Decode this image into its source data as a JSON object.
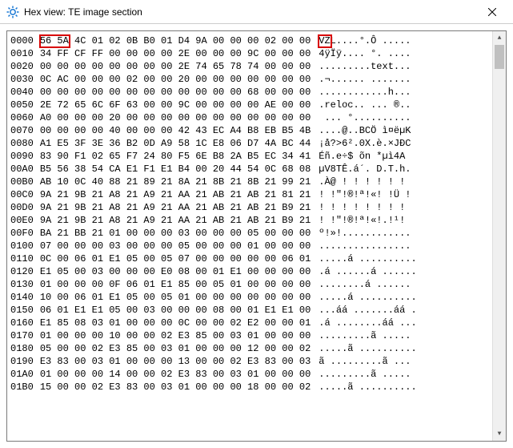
{
  "window": {
    "title": "Hex view: TE image section"
  },
  "highlights": {
    "hex_bytes": "56 5A",
    "ascii_chars": "VZ"
  },
  "rows": [
    {
      "offset": "0000",
      "hex": "56 5A 4C 01 02 0B B0 01 D4 9A 00 00 00 02 00 00",
      "ascii": "VZL....°.Ô ....."
    },
    {
      "offset": "0010",
      "hex": "34 FF CF FF 00 00 00 00 2E 00 00 00 9C 00 00 00",
      "ascii": "4ÿÏÿ.... °. ...."
    },
    {
      "offset": "0020",
      "hex": "00 00 00 00 00 00 00 00 2E 74 65 78 74 00 00 00",
      "ascii": ".........text..."
    },
    {
      "offset": "0030",
      "hex": "0C AC 00 00 00 02 00 00 20 00 00 00 00 00 00 00",
      "ascii": ".¬...... ......."
    },
    {
      "offset": "0040",
      "hex": "00 00 00 00 00 00 00 00 00 00 00 00 68 00 00 00",
      "ascii": "............h..."
    },
    {
      "offset": "0050",
      "hex": "2E 72 65 6C 6F 63 00 00 9C 00 00 00 00 AE 00 00",
      "ascii": ".reloc.. ... ®.."
    },
    {
      "offset": "0060",
      "hex": "A0 00 00 00 20 00 00 00 00 00 00 00 00 00 00 00",
      "ascii": " ... °.........."
    },
    {
      "offset": "0070",
      "hex": "00 00 00 00 40 00 00 00 42 43 EC A4 B8 EB B5 4B",
      "ascii": "....@..BCÖ ì¤ëµK"
    },
    {
      "offset": "0080",
      "hex": "A1 E5 3F 3E 36 B2 0D A9 58 1C E8 06 D7 4A BC 44",
      "ascii": "¡å?>6².0X.è.×JÐC"
    },
    {
      "offset": "0090",
      "hex": "83 90 F1 02 65 F7 24 80 F5 6E B8 2A B5 EC 34 41",
      "ascii": "Éñ.e÷$ õn *µì4A"
    },
    {
      "offset": "00A0",
      "hex": "B5 56 38 54 CA E1 F1 E1 B4 00 20 44 54 0C 68 08",
      "ascii": "µV8TÊ.á´. D.T.h."
    },
    {
      "offset": "00B0",
      "hex": "AB 10 0C 40 88 21 89 21 8A 21 8B 21 8B 21 99 21",
      "ascii": ".À@ ! ! ! ! ! !"
    },
    {
      "offset": "00C0",
      "hex": "9A 21 9B 21 A8 21 A9 21 AA 21 AB 21 AB 21 81 21",
      "ascii": "! !″!®!ª!«! !Ü !"
    },
    {
      "offset": "00D0",
      "hex": "9A 21 9B 21 A8 21 A9 21 AA 21 AB 21 AB 21 B9 21",
      "ascii": "! ! ! ! ! ! ! !"
    },
    {
      "offset": "00E0",
      "hex": "9A 21 9B 21 A8 21 A9 21 AA 21 AB 21 AB 21 B9 21",
      "ascii": "! !″!®!ª!«!.!¹!"
    },
    {
      "offset": "00F0",
      "hex": "BA 21 BB 21 01 00 00 00 03 00 00 00 05 00 00 00",
      "ascii": "º!»!............"
    },
    {
      "offset": "0100",
      "hex": "07 00 00 00 03 00 00 00 05 00 00 00 01 00 00 00",
      "ascii": "................"
    },
    {
      "offset": "0110",
      "hex": "0C 00 06 01 E1 05 00 05 07 00 00 00 00 00 06 01",
      "ascii": ".....á .........."
    },
    {
      "offset": "0120",
      "hex": "E1 05 00 03 00 00 00 E0 08 00 01 E1 00 00 00 00",
      "ascii": ".á ......á ......"
    },
    {
      "offset": "0130",
      "hex": "01 00 00 00 0F 06 01 E1 85 00 05 01 00 00 00 00",
      "ascii": "........á ......"
    },
    {
      "offset": "0140",
      "hex": "10 00 06 01 E1 05 00 05 01 00 00 00 00 00 00 00",
      "ascii": ".....á .........."
    },
    {
      "offset": "0150",
      "hex": "06 01 E1 E1 05 00 03 00 00 00 08 00 01 E1 E1 00",
      "ascii": "...áá .......áá ."
    },
    {
      "offset": "0160",
      "hex": "E1 85 08 03 01 00 00 00 0C 00 00 02 E2 00 00 01",
      "ascii": ".á ........áá ..."
    },
    {
      "offset": "0170",
      "hex": "01 00 00 00 10 00 00 02 E3 85 00 03 01 00 00 00",
      "ascii": ".........ã ....."
    },
    {
      "offset": "0180",
      "hex": "05 00 00 02 E3 85 00 03 01 00 00 00 12 00 00 02",
      "ascii": ".....ã .........."
    },
    {
      "offset": "0190",
      "hex": "E3 83 00 03 01 00 00 00 13 00 00 02 E3 83 00 03",
      "ascii": "ã .........ã ..."
    },
    {
      "offset": "01A0",
      "hex": "01 00 00 00 14 00 00 02 E3 83 00 03 01 00 00 00",
      "ascii": ".........ã ....."
    },
    {
      "offset": "01B0",
      "hex": "15 00 00 02 E3 83 00 03 01 00 00 00 18 00 00 02",
      "ascii": ".....ã .........."
    }
  ]
}
